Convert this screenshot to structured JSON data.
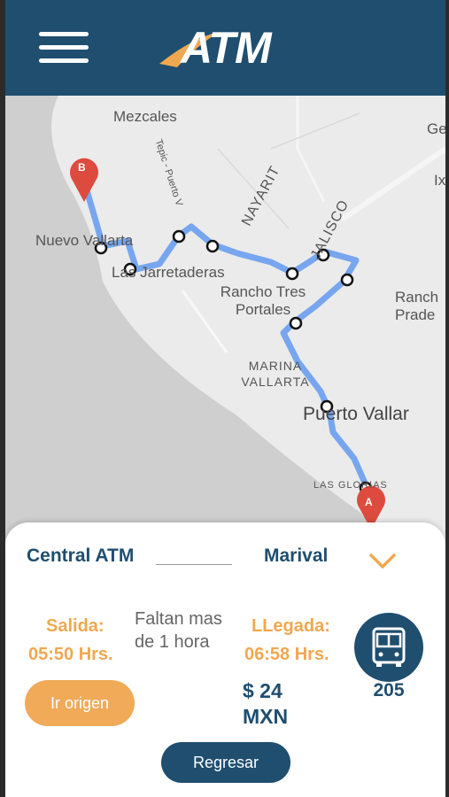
{
  "header": {
    "logo_text": "ATM"
  },
  "map": {
    "labels": {
      "mezcales": "Mezcales",
      "nuevo_vallarta": "Nuevo Vallarta",
      "las_jarretaderas": "Las Jarretaderas",
      "tepic_puerto": "Tepic - Puerto V",
      "nayarit": "NAYARIT",
      "jalisco": "JALISCO",
      "rancho_tres_portales": "Rancho Tres Portales",
      "rancho_prade": "Ranch Prade",
      "marina_vallarta": "MARINA VALLARTA",
      "puerto_vallarta": "Puerto Vallar",
      "las_glorias": "LAS GLORIAS",
      "ge": "Ge",
      "ix": "Ix"
    },
    "marker_a": "A",
    "marker_b": "B"
  },
  "trip": {
    "origin": "Central ATM",
    "destination": "Marival",
    "departure_label": "Salida:",
    "departure_time": "05:50 Hrs.",
    "remaining_text": "Faltan mas de 1 hora",
    "arrival_label": "LLegada:",
    "arrival_time": "06:58 Hrs.",
    "price": "$ 24 MXN",
    "bus_number": "205"
  },
  "buttons": {
    "ir_origen": "Ir origen",
    "regresar": "Regresar"
  },
  "colors": {
    "primary": "#1f4e6f",
    "accent": "#f0a850",
    "route": "#6a9ef0",
    "marker": "#dd4b3e"
  },
  "icons": [
    "menu-icon",
    "chevron-down-icon",
    "bus-icon",
    "map-marker-icon"
  ]
}
